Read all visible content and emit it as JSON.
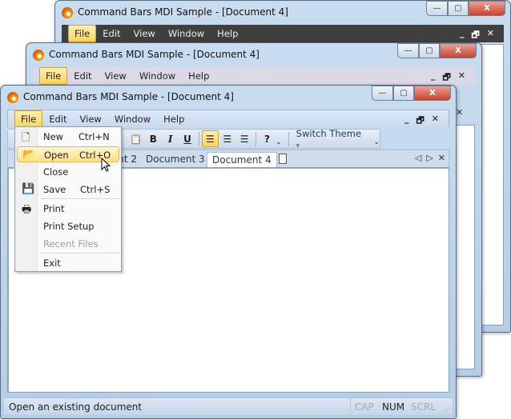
{
  "window_title": "Command Bars MDI Sample - [Document 4]",
  "caption": {
    "minimize": "—",
    "maximize": "▢",
    "close": "X"
  },
  "menubar": [
    "File",
    "Edit",
    "View",
    "Window",
    "Help"
  ],
  "mdi_controls": {
    "minimize": "_",
    "restore": "🗗",
    "close": "✕"
  },
  "toolbar": {
    "bold": "B",
    "italic": "I",
    "underline": "U",
    "help": "?",
    "switch_theme": "Switch Theme",
    "dropdown": "▾",
    "overflow": "⌄"
  },
  "tabs": [
    "Document 2",
    "Document 3",
    "Document 4"
  ],
  "tab_partial": "t 2",
  "tab_nav": {
    "left": "◁",
    "right": "▷",
    "close": "✕"
  },
  "file_menu": [
    {
      "label": "New",
      "shortcut": "Ctrl+N",
      "icon": "new-document-icon"
    },
    {
      "label": "Open",
      "shortcut": "Ctrl+O",
      "icon": "open-folder-icon",
      "highlighted": true
    },
    {
      "label": "Close",
      "shortcut": ""
    },
    {
      "label": "Save",
      "shortcut": "Ctrl+S",
      "icon": "save-icon"
    },
    {
      "label": "Print",
      "shortcut": "",
      "icon": "printer-icon"
    },
    {
      "label": "Print Setup",
      "shortcut": ""
    },
    {
      "label": "Recent Files",
      "shortcut": "",
      "disabled": true
    },
    {
      "label": "Exit",
      "shortcut": ""
    }
  ],
  "status": {
    "message": "Open an existing document",
    "cap": "CAP",
    "num": "NUM",
    "scrl": "SCRL"
  },
  "colors": {
    "highlight": "#ffd454",
    "back_menubar": "#3f3f3f",
    "middle_menubar": "#dcd8e8"
  }
}
